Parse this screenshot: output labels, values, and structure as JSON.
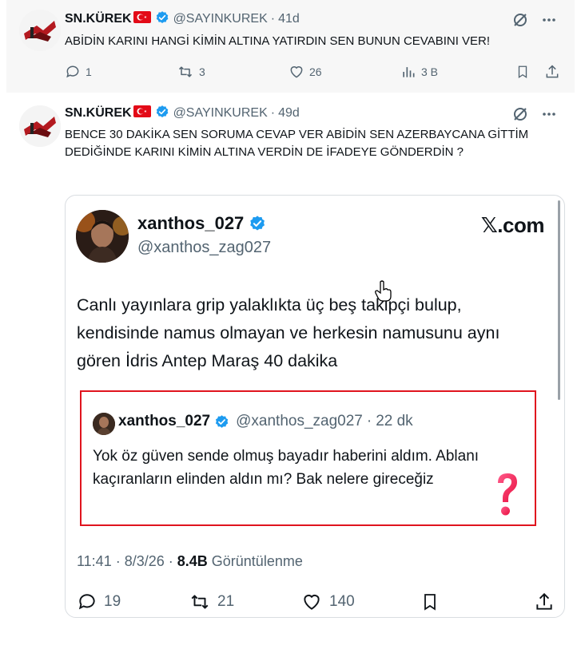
{
  "tweet1": {
    "author_name": "SN.KÜREK",
    "handle": "@SAYINKUREK",
    "separator": "·",
    "time": "41d",
    "text": "ABİDİN KARINI HANGİ KİMİN ALTINA YATIRDIN SEN BUNUN CEVABINI VER!",
    "replies": "1",
    "reposts": "3",
    "likes": "26",
    "views": "3 B"
  },
  "tweet2": {
    "author_name": "SN.KÜREK",
    "handle": "@SAYINKUREK",
    "separator": "·",
    "time": "49d",
    "text": "BENCE 30 DAKİKA SEN SORUMA CEVAP VER ABİDİN SEN AZERBAYCANA GİTTİM DEDİĞİNDE KARINI KİMİN ALTINA VERDİN DE İFADEYE GÖNDERDİN ?",
    "card": {
      "author_name": "xanthos_027",
      "handle": "@xanthos_zag027",
      "brand": "𝕏.com",
      "body": "Canlı yayınlara grip yalaklıkta üç beş takipçi bulup, kendisinde namus olmayan ve herkesin namusunu aynı gören İdris Antep Maraş 40 dakika",
      "quote": {
        "author_name": "xanthos_027",
        "handle": "@xanthos_zag027",
        "separator": "·",
        "time": "22 dk",
        "text": "Yok öz güven sende olmuş bayadır haberini aldım. Ablanı kaçıranların elinden aldın mı? Bak nelere gireceğiz"
      },
      "meta_time": "11:41 · 8/3/26 · ",
      "meta_views": "8.4B",
      "meta_views_label": " Görüntülenme",
      "replies": "19",
      "reposts": "21",
      "likes": "140"
    }
  },
  "colors": {
    "text": "#0f1419",
    "muted": "#536471",
    "verified": "#1d9bf0",
    "highlight": "#e0141e",
    "question": "#ff2d6f"
  }
}
